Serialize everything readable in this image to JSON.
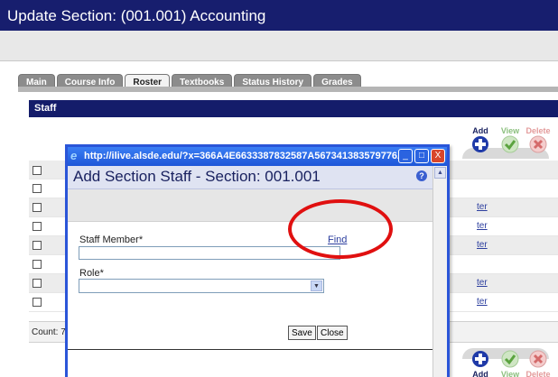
{
  "page": {
    "title": "Update Section: (001.001) Accounting"
  },
  "tabs": [
    {
      "label": "Main"
    },
    {
      "label": "Course Info"
    },
    {
      "label": "Roster"
    },
    {
      "label": "Textbooks"
    },
    {
      "label": "Status History"
    },
    {
      "label": "Grades"
    }
  ],
  "active_tab": "Roster",
  "staff": {
    "header": "Staff",
    "actions": {
      "add": "Add",
      "view": "View",
      "delete": "Delete"
    },
    "row_link_text": "ter",
    "count_label": "Count: 7"
  },
  "colors": {
    "title_bar": "#171e6e",
    "accent_blue": "#2a55d8",
    "highlight_red": "#e01010"
  },
  "popup": {
    "url": "http://ilive.alsde.edu/?x=366A4E6633387832587A567341383579776A...",
    "title": "Add Section Staff - Section: 001.001",
    "staff_member_label": "Staff Member*",
    "find_link": "Find",
    "staff_member_value": "",
    "role_label": "Role*",
    "role_value": "",
    "save_label": "Save",
    "close_label": "Close",
    "window_buttons": {
      "minimize": "_",
      "maximize": "□",
      "close": "X"
    },
    "help": "?"
  }
}
